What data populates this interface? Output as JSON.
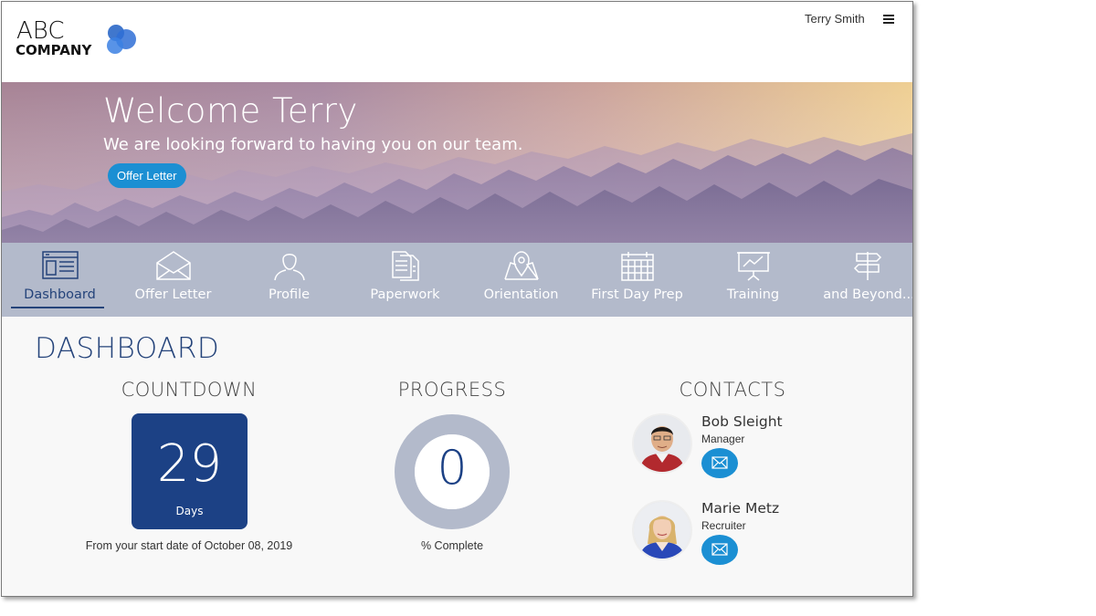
{
  "header": {
    "logo_top": "ABC",
    "logo_bottom": "COMPANY",
    "user_name": "Terry Smith",
    "menu_icon": "hamburger-icon"
  },
  "hero": {
    "title": "Welcome Terry",
    "subtitle": "We are looking forward to having you on our team.",
    "offer_button": "Offer Letter"
  },
  "nav": {
    "active": "Dashboard",
    "items": [
      {
        "label": "Dashboard",
        "icon": "dashboard-window-icon"
      },
      {
        "label": "Offer Letter",
        "icon": "envelope-icon"
      },
      {
        "label": "Profile",
        "icon": "user-icon"
      },
      {
        "label": "Paperwork",
        "icon": "documents-icon"
      },
      {
        "label": "Orientation",
        "icon": "map-pin-icon"
      },
      {
        "label": "First Day Prep",
        "icon": "calendar-icon"
      },
      {
        "label": "Training",
        "icon": "presentation-board-icon"
      },
      {
        "label": "and Beyond...",
        "icon": "signpost-icon"
      }
    ]
  },
  "dashboard": {
    "title": "DASHBOARD",
    "countdown": {
      "title": "COUNTDOWN",
      "value": "29",
      "unit": "Days",
      "note": "From your start date of October 08, 2019"
    },
    "progress": {
      "title": "PROGRESS",
      "value": "0",
      "percent": 0,
      "note": "% Complete"
    },
    "contacts": {
      "title": "CONTACTS",
      "people": [
        {
          "name": "Bob Sleight",
          "role": "Manager"
        },
        {
          "name": "Marie Metz",
          "role": "Recruiter"
        }
      ]
    }
  },
  "colors": {
    "brand_blue": "#1c4185",
    "accent_blue": "#1b8fd3",
    "nav_bg": "#b3bacb",
    "progress_track": "#b3bacb"
  }
}
